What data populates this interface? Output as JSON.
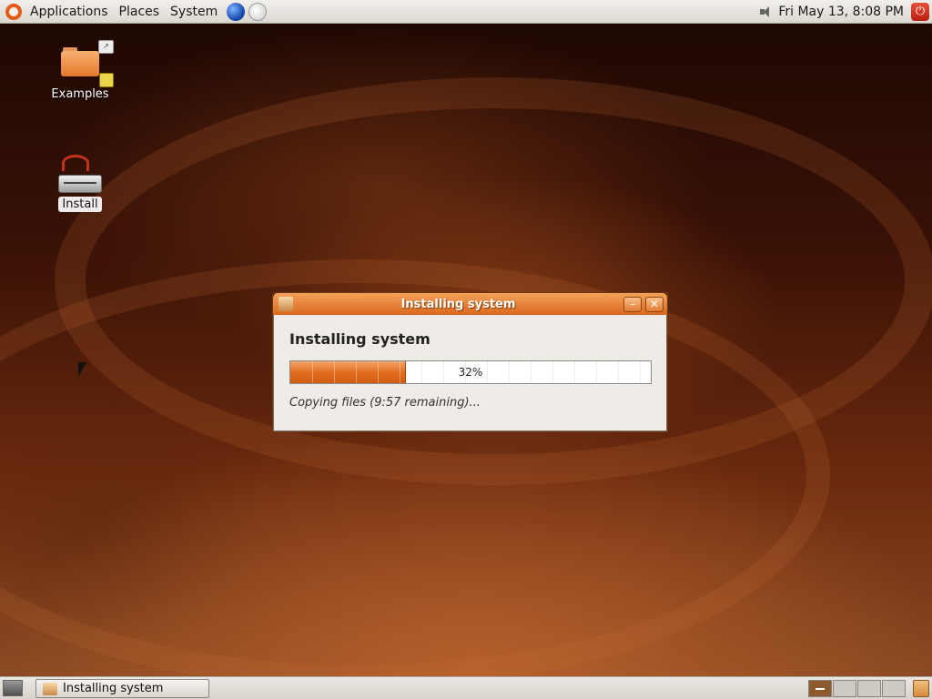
{
  "top_panel": {
    "menus": [
      "Applications",
      "Places",
      "System"
    ],
    "clock": "Fri May 13,  8:08 PM",
    "power_glyph": "⏻"
  },
  "desktop": {
    "icons": [
      {
        "label": "Examples",
        "icon": "folder-icon"
      },
      {
        "label": "Install",
        "icon": "disk-install-icon"
      }
    ]
  },
  "dialog": {
    "title": "Installing system",
    "heading": "Installing system",
    "progress": {
      "percent": 32,
      "text": "32%"
    },
    "status": "Copying files (9:57 remaining)...",
    "minimize_glyph": "–",
    "close_glyph": "✕"
  },
  "bottom_panel": {
    "task": "Installing system",
    "workspaces": 4,
    "active_workspace": 1
  },
  "colors": {
    "titlebar": "#e07b30",
    "progress_fill": "#e06a1c"
  }
}
